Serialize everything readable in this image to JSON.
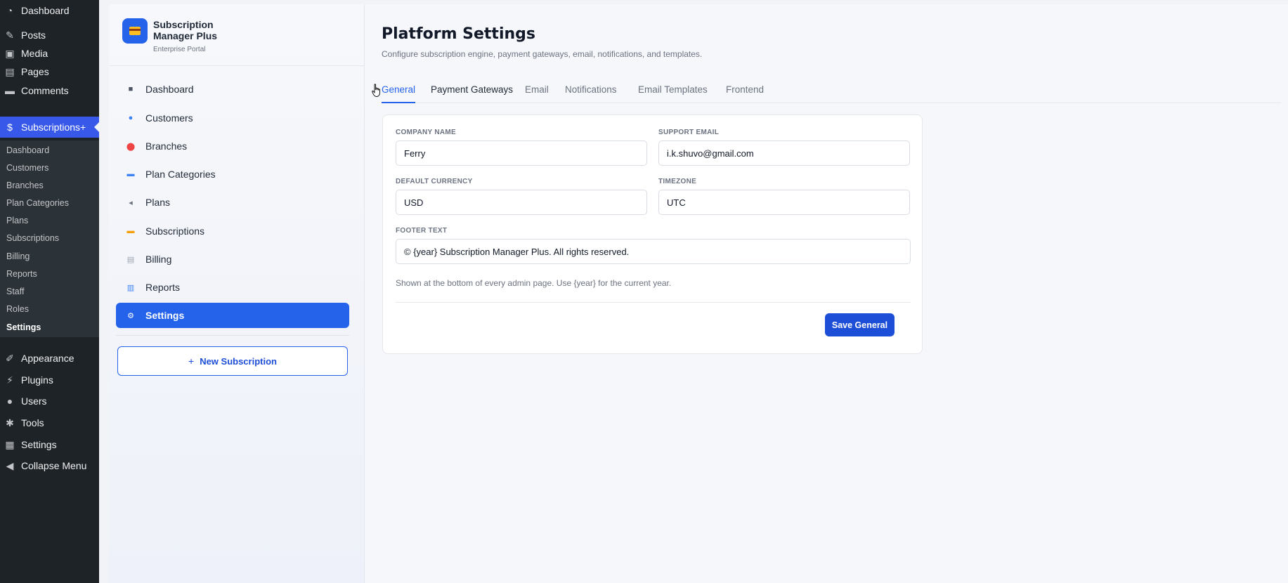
{
  "wp_menu": {
    "items_top": [
      {
        "label": "Dashboard",
        "icon": "dashboard-gauge-icon"
      },
      {
        "label": "Posts",
        "icon": "pushpin-icon"
      },
      {
        "label": "Media",
        "icon": "media-icon"
      },
      {
        "label": "Pages",
        "icon": "pages-icon"
      },
      {
        "label": "Comments",
        "icon": "comment-bubble-icon"
      },
      {
        "label": "Subscriptions+",
        "icon": "dollar-circle-icon"
      }
    ],
    "submenu": [
      "Dashboard",
      "Customers",
      "Branches",
      "Plan Categories",
      "Plans",
      "Subscriptions",
      "Billing",
      "Reports",
      "Staff",
      "Roles",
      "Settings"
    ],
    "items_bottom": [
      {
        "label": "Appearance",
        "icon": "paintbrush-icon"
      },
      {
        "label": "Plugins",
        "icon": "plug-icon"
      },
      {
        "label": "Users",
        "icon": "user-icon"
      },
      {
        "label": "Tools",
        "icon": "wrench-icon"
      },
      {
        "label": "Settings",
        "icon": "settings-grid-icon"
      },
      {
        "label": "Collapse Menu",
        "icon": "collapse-arrow-icon"
      }
    ]
  },
  "brand": {
    "title": "Subscription Manager Plus",
    "subtitle": "Enterprise Portal",
    "icon": "credit-card-icon"
  },
  "plugin_nav": [
    {
      "label": "Dashboard",
      "icon": "square-icon"
    },
    {
      "label": "Customers",
      "icon": "people-icon"
    },
    {
      "label": "Branches",
      "icon": "map-pin-icon"
    },
    {
      "label": "Plan Categories",
      "icon": "folder-icon"
    },
    {
      "label": "Plans",
      "icon": "tag-icon"
    },
    {
      "label": "Subscriptions",
      "icon": "credit-card-icon"
    },
    {
      "label": "Billing",
      "icon": "receipt-icon"
    },
    {
      "label": "Reports",
      "icon": "bar-chart-icon"
    },
    {
      "label": "Settings",
      "icon": "gear-icon"
    }
  ],
  "new_subscription_label": "New Subscription",
  "page": {
    "title": "Platform Settings",
    "description": "Configure subscription engine, payment gateways, email, notifications, and templates."
  },
  "tabs": [
    "General",
    "Payment Gateways",
    "Email",
    "Notifications",
    "Email Templates",
    "Frontend"
  ],
  "form": {
    "company_name_label": "COMPANY NAME",
    "company_name_value": "Ferry",
    "support_email_label": "SUPPORT EMAIL",
    "support_email_value": "i.k.shuvo@gmail.com",
    "default_currency_label": "DEFAULT CURRENCY",
    "default_currency_value": "USD",
    "timezone_label": "TIMEZONE",
    "timezone_value": "UTC",
    "footer_text_label": "FOOTER TEXT",
    "footer_text_value": "© {year} Subscription Manager Plus. All rights reserved.",
    "footer_help": "Shown at the bottom of every admin page. Use {year} for the current year.",
    "save_label": "Save General"
  },
  "colors": {
    "accent": "#2563eb",
    "wp_sidebar": "#1d2327",
    "wp_active": "#3858e9"
  }
}
